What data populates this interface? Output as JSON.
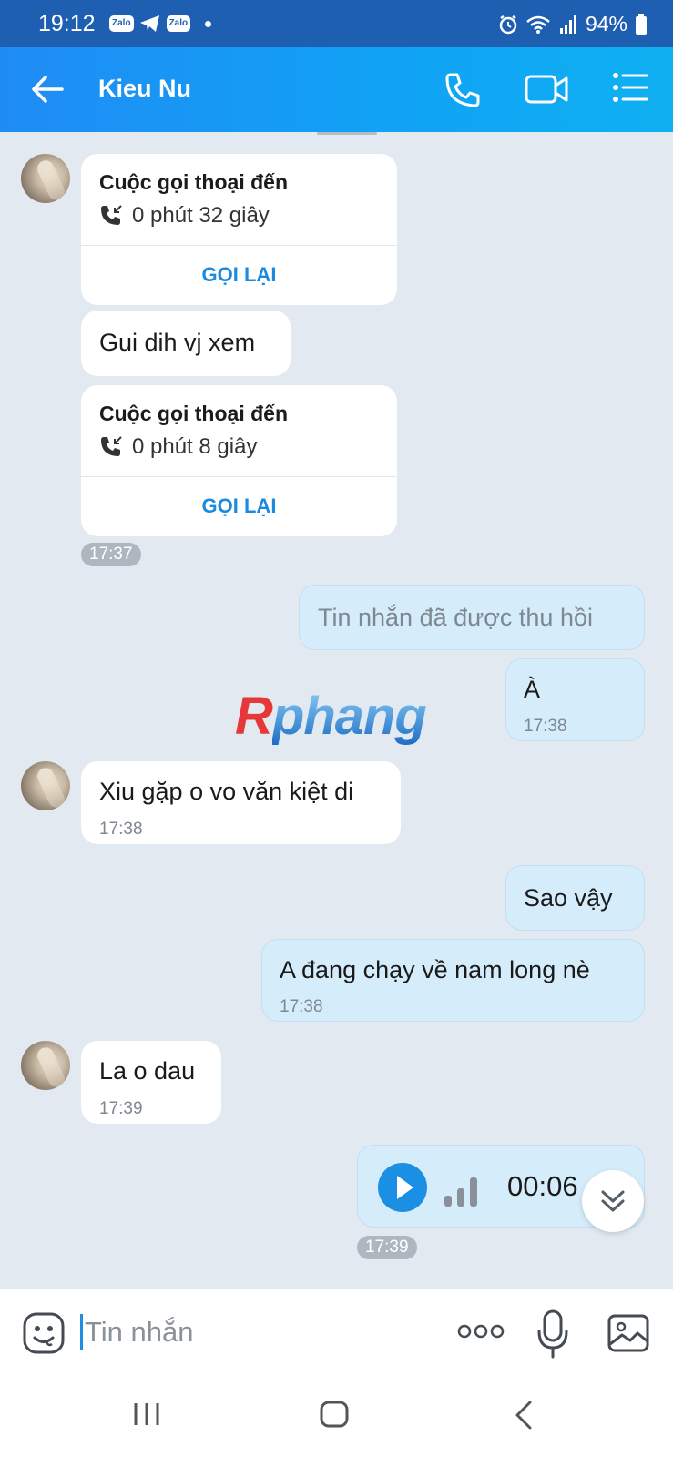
{
  "status_bar": {
    "time": "19:12",
    "zalo_label": "Zalo",
    "battery": "94%"
  },
  "header": {
    "contact_name": "Kieu Nu"
  },
  "messages": {
    "call1": {
      "title": "Cuộc gọi thoại đến",
      "duration": "0 phút 32 giây",
      "action": "GỌI LẠI"
    },
    "m1": {
      "text": "Gui dih vj xem"
    },
    "call2": {
      "title": "Cuộc gọi thoại đến",
      "duration": "0 phút 8 giây",
      "action": "GỌI LẠI"
    },
    "time_1737": "17:37",
    "recalled": {
      "text": "Tin nhắn đã được thu hồi"
    },
    "m2": {
      "text": "À",
      "time": "17:38"
    },
    "m3": {
      "text": "Xiu gặp o vo văn kiệt di",
      "time": "17:38"
    },
    "m4": {
      "text": "Sao vậy"
    },
    "m5": {
      "text": "A đang chạy về nam long nè",
      "time": "17:38"
    },
    "m6": {
      "text": "La o dau",
      "time": "17:39"
    },
    "voice": {
      "duration": "00:06"
    },
    "time_1739": "17:39"
  },
  "watermark": {
    "first": "R",
    "rest": "phang"
  },
  "input": {
    "placeholder": "Tin nhắn"
  },
  "colors": {
    "header_start": "#1f8cf5",
    "header_end": "#0fb0f2",
    "accent": "#1b8fe4",
    "outgoing_bubble": "#d5ecfb",
    "chat_bg": "#e2e9f1"
  }
}
